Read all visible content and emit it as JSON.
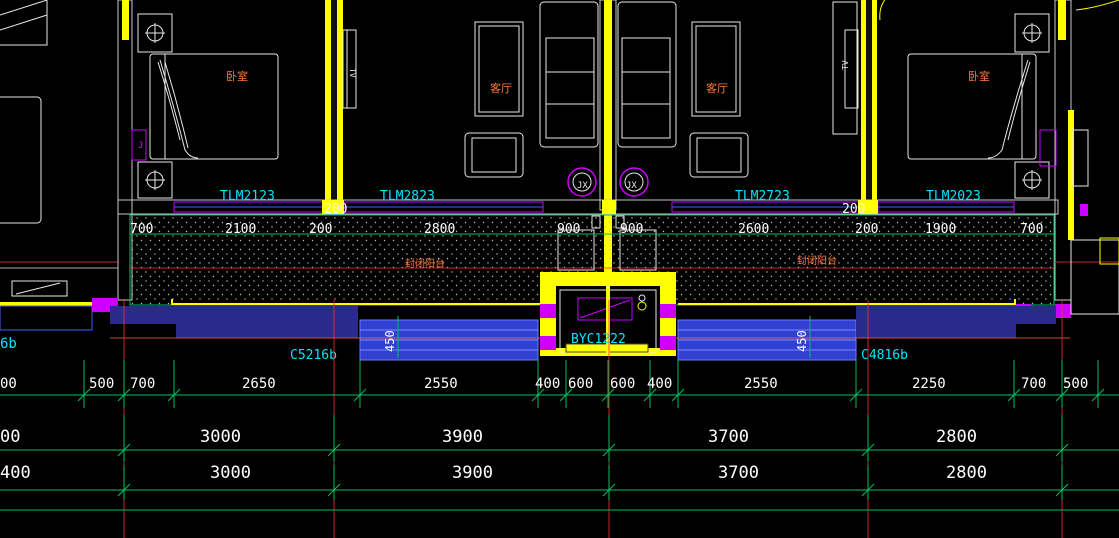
{
  "drawing": {
    "colors": {
      "background": "#000000",
      "wall_yellow": "#ffff00",
      "column_magenta": "#cc00ff",
      "dim_green": "#00c060",
      "dim_text": "#ffffff",
      "tag_cyan": "#00e5ff",
      "furniture": "#e8e8e8",
      "room_text": "#ff7a3a",
      "window_blue": "#4a5cff",
      "axis_red": "#ff3030",
      "gray": "#8a8a8a"
    },
    "windows": {
      "tlm1": "TLM2123",
      "tlm2": "TLM2823",
      "tlm3": "TLM2723",
      "tlm4": "TLM2023"
    },
    "openings": {
      "c_left": "C5216b",
      "c_right": "C4816b",
      "byc": "BYC1222",
      "left_edge": "6b"
    },
    "rooms": {
      "bedroom_left": "卧室",
      "living_left": "客厅",
      "living_right": "客厅",
      "bedroom_right": "卧室",
      "balcony_left": "封闭阳台",
      "balcony_right": "封闭阳台",
      "tv_left": "TV",
      "tv_right": "TV"
    },
    "top_dims": [
      "700",
      "2100",
      "200",
      "2800",
      "900",
      "900",
      "2600",
      "200",
      "200",
      "1900",
      "700",
      "200"
    ],
    "row1": [
      "00",
      "500",
      "700",
      "2650",
      "2550",
      "400",
      "600",
      "600",
      "400",
      "2550",
      "2250",
      "700",
      "500"
    ],
    "side_dims": {
      "left": "450",
      "right": "450"
    },
    "row2": [
      "00",
      "3000",
      "3900",
      "3700",
      "2800"
    ],
    "row3": [
      "400",
      "3000",
      "3900",
      "3700",
      "2800"
    ]
  }
}
